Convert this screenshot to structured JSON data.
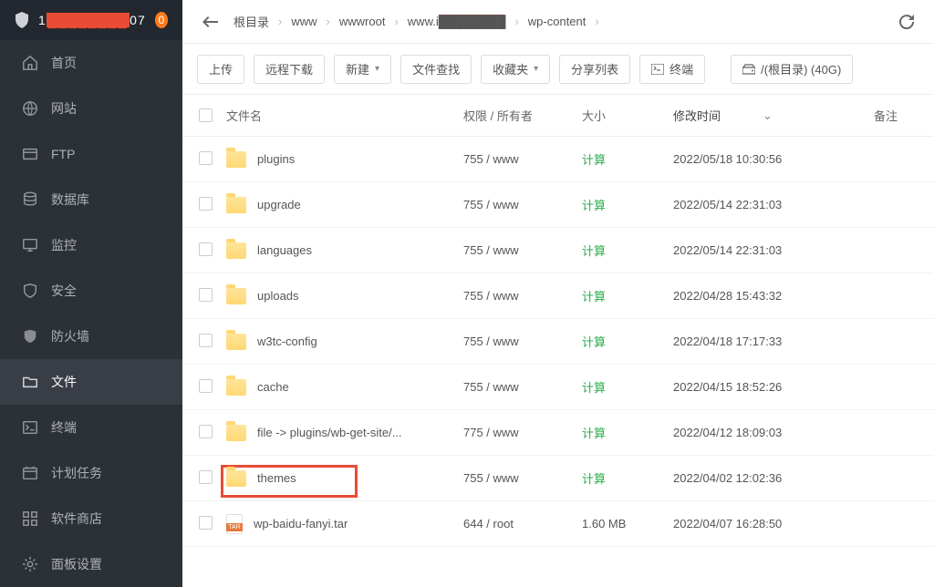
{
  "header": {
    "ip_prefix": "1",
    "ip_masked": "████████",
    "ip_suffix": "07",
    "badge": "0"
  },
  "sidebar": {
    "items": [
      {
        "label": "首页",
        "icon": "home"
      },
      {
        "label": "网站",
        "icon": "globe"
      },
      {
        "label": "FTP",
        "icon": "ftp"
      },
      {
        "label": "数据库",
        "icon": "database"
      },
      {
        "label": "监控",
        "icon": "monitor"
      },
      {
        "label": "安全",
        "icon": "shield"
      },
      {
        "label": "防火墙",
        "icon": "firewall"
      },
      {
        "label": "文件",
        "icon": "folder",
        "active": true
      },
      {
        "label": "终端",
        "icon": "terminal"
      },
      {
        "label": "计划任务",
        "icon": "cron"
      },
      {
        "label": "软件商店",
        "icon": "apps"
      },
      {
        "label": "面板设置",
        "icon": "settings"
      }
    ]
  },
  "breadcrumbs": [
    {
      "label": "根目录"
    },
    {
      "label": "www"
    },
    {
      "label": "wwwroot"
    },
    {
      "label": "www.i██████████",
      "redacted": true
    },
    {
      "label": "wp-content"
    }
  ],
  "toolbar": {
    "upload": "上传",
    "remote_download": "远程下载",
    "new": "新建",
    "file_search": "文件查找",
    "favorites": "收藏夹",
    "share_list": "分享列表",
    "terminal": "终端",
    "disk": "/(根目录) (40G)"
  },
  "columns": {
    "name": "文件名",
    "perm": "权限 / 所有者",
    "size": "大小",
    "mtime": "修改时间",
    "note": "备注"
  },
  "files": [
    {
      "name": "plugins",
      "type": "folder",
      "perm": "755 / www",
      "size": "计算",
      "size_calc": true,
      "mtime": "2022/05/18 10:30:56"
    },
    {
      "name": "upgrade",
      "type": "folder",
      "perm": "755 / www",
      "size": "计算",
      "size_calc": true,
      "mtime": "2022/05/14 22:31:03"
    },
    {
      "name": "languages",
      "type": "folder",
      "perm": "755 / www",
      "size": "计算",
      "size_calc": true,
      "mtime": "2022/05/14 22:31:03"
    },
    {
      "name": "uploads",
      "type": "folder",
      "perm": "755 / www",
      "size": "计算",
      "size_calc": true,
      "mtime": "2022/04/28 15:43:32"
    },
    {
      "name": "w3tc-config",
      "type": "folder",
      "perm": "755 / www",
      "size": "计算",
      "size_calc": true,
      "mtime": "2022/04/18 17:17:33"
    },
    {
      "name": "cache",
      "type": "folder",
      "perm": "755 / www",
      "size": "计算",
      "size_calc": true,
      "mtime": "2022/04/15 18:52:26"
    },
    {
      "name": "file -> plugins/wb-get-site/...",
      "type": "folder",
      "perm": "775 / www",
      "size": "计算",
      "size_calc": true,
      "mtime": "2022/04/12 18:09:03"
    },
    {
      "name": "themes",
      "type": "folder",
      "perm": "755 / www",
      "size": "计算",
      "size_calc": true,
      "mtime": "2022/04/02 12:02:36",
      "highlight": true
    },
    {
      "name": "wp-baidu-fanyi.tar",
      "type": "tar",
      "perm": "644 / root",
      "size": "1.60 MB",
      "size_calc": false,
      "mtime": "2022/04/07 16:28:50"
    }
  ]
}
